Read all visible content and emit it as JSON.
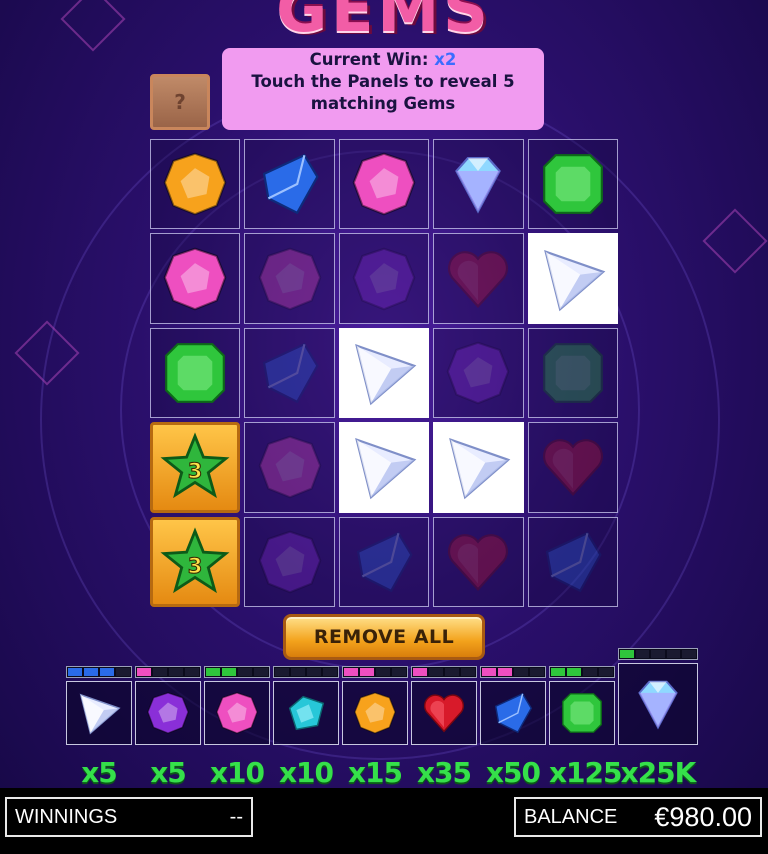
{
  "game": {
    "title": "GEMS",
    "mystery_symbol": "?",
    "info_line1_prefix": "Current Win: ",
    "info_line1_multiplier": "x2",
    "info_line2": "Touch the Panels to reveal 5 matching Gems",
    "remove_all_label": "REMOVE ALL"
  },
  "colors": {
    "orange": "#f7a21c",
    "blue": "#2a6be8",
    "pink": "#ee4fc0",
    "diamond": "#8fd8ff",
    "green": "#2fc63c",
    "purple": "#8a2fd8",
    "red": "#d81a2a",
    "cyan": "#27c7d8",
    "white": "#e8ecff"
  },
  "grid": [
    [
      {
        "gem": "orange",
        "state": "revealed"
      },
      {
        "gem": "blue",
        "state": "revealed"
      },
      {
        "gem": "pink",
        "state": "revealed"
      },
      {
        "gem": "diamond",
        "state": "revealed"
      },
      {
        "gem": "green",
        "state": "revealed"
      }
    ],
    [
      {
        "gem": "pink",
        "state": "revealed"
      },
      {
        "gem": "pink",
        "state": "hidden"
      },
      {
        "gem": "purple",
        "state": "hidden"
      },
      {
        "gem": "red",
        "state": "hidden"
      },
      {
        "gem": "white",
        "state": "matched"
      }
    ],
    [
      {
        "gem": "green",
        "state": "revealed"
      },
      {
        "gem": "blue",
        "state": "hidden"
      },
      {
        "gem": "white",
        "state": "matched"
      },
      {
        "gem": "purple",
        "state": "hidden"
      },
      {
        "gem": "green",
        "state": "hidden"
      }
    ],
    [
      {
        "gem": "star",
        "state": "star",
        "label": "3"
      },
      {
        "gem": "pink",
        "state": "hidden"
      },
      {
        "gem": "white",
        "state": "matched"
      },
      {
        "gem": "white",
        "state": "matched"
      },
      {
        "gem": "red",
        "state": "hidden"
      }
    ],
    [
      {
        "gem": "star",
        "state": "star",
        "label": "3"
      },
      {
        "gem": "purple",
        "state": "hidden"
      },
      {
        "gem": "blue",
        "state": "hidden"
      },
      {
        "gem": "red",
        "state": "hidden"
      },
      {
        "gem": "blue",
        "state": "hidden"
      }
    ]
  ],
  "paytable": [
    {
      "gem": "white",
      "multiplier": "x5",
      "bar_color": "#2a6be8",
      "progress": 0.75
    },
    {
      "gem": "purple",
      "multiplier": "x5",
      "bar_color": "#ee4fc0",
      "progress": 0.25
    },
    {
      "gem": "pink",
      "multiplier": "x10",
      "bar_color": "#2fc63c",
      "progress": 0.5
    },
    {
      "gem": "cyan",
      "multiplier": "x10",
      "bar_color": "#2fc63c",
      "progress": 0
    },
    {
      "gem": "orange",
      "multiplier": "x15",
      "bar_color": "#ee4fc0",
      "progress": 0.5
    },
    {
      "gem": "red",
      "multiplier": "x35",
      "bar_color": "#ee4fc0",
      "progress": 0.25
    },
    {
      "gem": "blue",
      "multiplier": "x50",
      "bar_color": "#ee4fc0",
      "progress": 0.5
    },
    {
      "gem": "green",
      "multiplier": "x125",
      "bar_color": "#2fc63c",
      "progress": 0.5
    },
    {
      "gem": "diamond",
      "multiplier": "x25K",
      "bar_color": "#2fc63c",
      "progress": 0.2
    }
  ],
  "footer": {
    "winnings_label": "WINNINGS",
    "winnings_value": "--",
    "balance_label": "BALANCE",
    "balance_value": "€980.00"
  }
}
